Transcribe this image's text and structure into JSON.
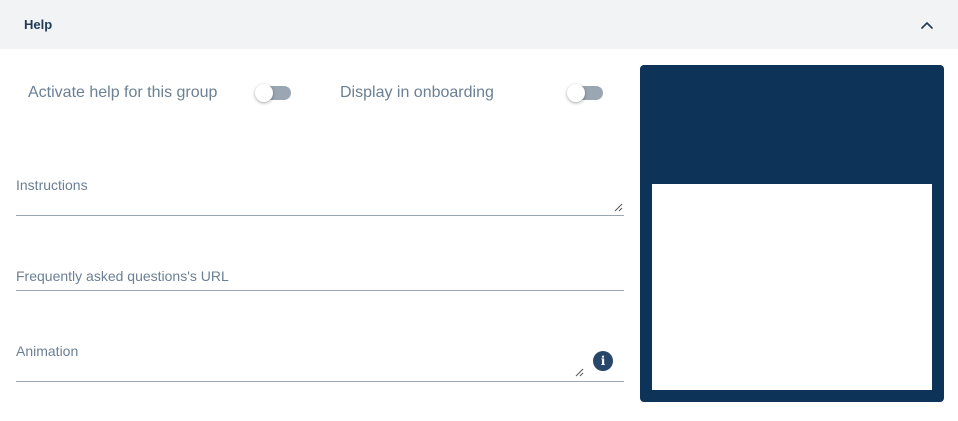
{
  "header": {
    "title": "Help",
    "collapse_icon": "chevron-up-icon"
  },
  "toggles": {
    "activate_help": {
      "label": "Activate help for this group",
      "checked": false
    },
    "display_onboarding": {
      "label": "Display in onboarding",
      "checked": false
    }
  },
  "fields": {
    "instructions": {
      "label": "Instructions",
      "value": ""
    },
    "faq_url": {
      "label": "Frequently asked questions's URL",
      "value": ""
    },
    "animation": {
      "label": "Animation",
      "value": ""
    }
  },
  "icons": {
    "info": "info-icon"
  },
  "colors": {
    "accent": "#0e3358",
    "header_bg": "#f2f3f5",
    "text": "#6b8094"
  }
}
